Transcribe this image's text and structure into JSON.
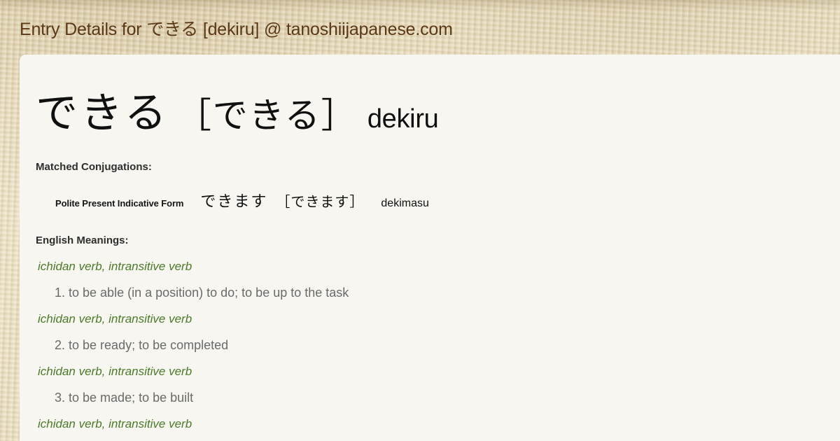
{
  "header": {
    "title_prefix": "Entry Details for ",
    "title_word": "できる",
    "title_suffix": " [dekiru] @ tanoshiijapanese.com",
    "text_color": "#5b3916"
  },
  "entry": {
    "word": "できる",
    "word_bracketed": "［できる］",
    "romaji": "dekiru"
  },
  "conjugations": {
    "heading": "Matched Conjugations:",
    "rows": [
      {
        "name": "Polite Present Indicative Form",
        "kana": "できます",
        "kana_bracketed": "［できます］",
        "romaji": "dekimasu"
      }
    ]
  },
  "meanings": {
    "heading": "English Meanings:",
    "pos_color": "#4a7a28",
    "text_color": "#6a6a6a",
    "groups": [
      {
        "pos": "ichidan verb, intransitive verb",
        "text": "1. to be able (in a position) to do; to be up to the task"
      },
      {
        "pos": "ichidan verb, intransitive verb",
        "text": "2. to be ready; to be completed"
      },
      {
        "pos": "ichidan verb, intransitive verb",
        "text": "3. to be made; to be built"
      },
      {
        "pos": "ichidan verb, intransitive verb",
        "text": ""
      }
    ]
  },
  "colors": {
    "panel_background": "#f7f6f1",
    "page_background": "#e7dcc0"
  }
}
